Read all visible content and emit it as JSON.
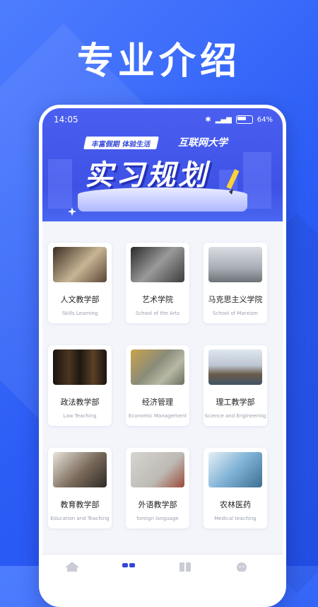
{
  "headline": "专业介绍",
  "status_bar": {
    "time": "14:05",
    "battery": "64%"
  },
  "banner": {
    "ribbon": "丰富假期 体验生活",
    "university": "互联网大学",
    "title": "实习规划"
  },
  "departments": [
    {
      "name": "人文教学部",
      "en": "Skills Learning",
      "photo": "book-photo"
    },
    {
      "name": "艺术学院",
      "en": "School of the Arts",
      "photo": "gallery-photo"
    },
    {
      "name": "马克思主义学院",
      "en": "School of Marxism",
      "photo": "statue-photo"
    },
    {
      "name": "政法教学部",
      "en": "Law Teaching",
      "photo": "library-photo"
    },
    {
      "name": "经济管理",
      "en": "Economic Management",
      "photo": "money-photo"
    },
    {
      "name": "理工教学部",
      "en": "Science and Engineering",
      "photo": "bridge-photo"
    },
    {
      "name": "教育教学部",
      "en": "Education and Teaching",
      "photo": "classroom-photo"
    },
    {
      "name": "外语教学部",
      "en": "foreign language",
      "photo": "blackboard-photo"
    },
    {
      "name": "农林医药",
      "en": "Medical teaching",
      "photo": "lab-photo"
    }
  ],
  "colors": {
    "primary": "#2b5cf5",
    "banner": "#3e52e6",
    "tab_active": "#3346d8"
  }
}
